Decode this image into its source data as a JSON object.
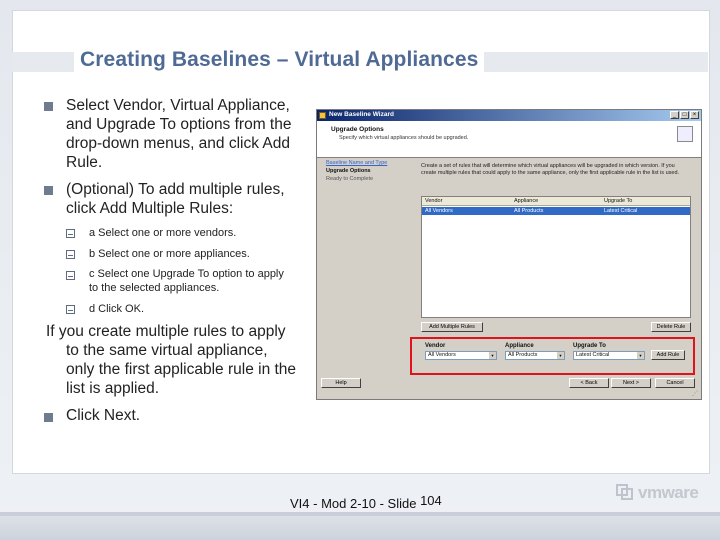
{
  "slide": {
    "title": "Creating Baselines – Virtual Appliances",
    "bullets": [
      {
        "lines": [
          "Select Vendor, Virtual Appliance,",
          "and Upgrade To options from the",
          "drop-down menus, and click Add",
          "Rule."
        ]
      },
      {
        "lines": [
          "(Optional) To add multiple rules,",
          "click Add Multiple Rules:"
        ]
      }
    ],
    "sub_items": [
      {
        "lines": [
          "a Select one or more vendors."
        ]
      },
      {
        "lines": [
          "b Select one or more appliances."
        ]
      },
      {
        "lines": [
          "c Select one Upgrade To option to apply",
          "to the selected appliances."
        ]
      },
      {
        "lines": [
          "d Click OK."
        ]
      }
    ],
    "note_lines": [
      "If you create multiple rules to apply",
      "to the same virtual appliance,",
      "only the first applicable rule in the",
      "list is applied."
    ],
    "last_bullet": "Click Next.",
    "footer_text": "VI4 - Mod 2-10 - Slide",
    "page_number": "104",
    "logo_text": "vmware"
  },
  "dialog": {
    "title": "New Baseline Wizard",
    "header_title": "Upgrade Options",
    "header_subtitle": "Specify which virtual appliances should be upgraded.",
    "steps": [
      "Baseline Name and Type",
      "Upgrade Options",
      "Ready to Complete"
    ],
    "description": "Create a set of rules that will determine which virtual appliances will be upgraded in which version. If you create multiple rules that could apply to the same appliance, only the first applicable rule in the list is used.",
    "grid_headers": [
      "Vendor",
      "Appliance",
      "Upgrade To"
    ],
    "grid_row": [
      "All Vendors",
      "All Products",
      "Latest Critical"
    ],
    "add_multiple_rules_label": "Add Multiple Rules",
    "delete_rule_label": "Delete Rule",
    "vendor_label": "Vendor",
    "appliance_label": "Appliance",
    "upgrade_to_label": "Upgrade To",
    "vendor_value": "All Vendors",
    "appliance_value": "All Products",
    "upgrade_to_value": "Latest Critical",
    "add_rule_label": "Add Rule",
    "help_label": "Help",
    "back_label": "< Back",
    "next_label": "Next >",
    "cancel_label": "Cancel",
    "window_controls": [
      "_",
      "□",
      "×"
    ]
  },
  "colors": {
    "title": "#4f6a94",
    "highlight_box": "#e0121c",
    "selection": "#316ac5"
  }
}
